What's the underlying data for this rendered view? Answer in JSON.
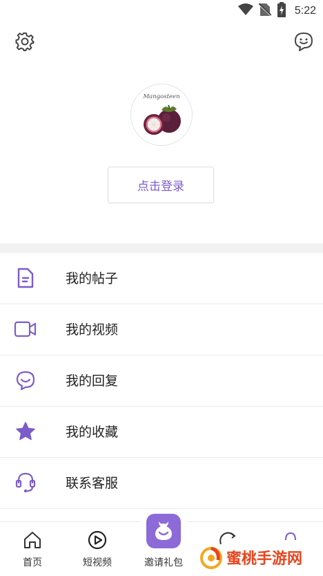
{
  "status_bar": {
    "time": "5:22"
  },
  "profile": {
    "avatar_text": "Mangosteen",
    "login_label": "点击登录"
  },
  "menu": {
    "items": [
      {
        "label": "我的帖子",
        "icon": "document-icon"
      },
      {
        "label": "我的视频",
        "icon": "video-camera-icon"
      },
      {
        "label": "我的回复",
        "icon": "chat-smile-icon"
      },
      {
        "label": "我的收藏",
        "icon": "star-icon"
      },
      {
        "label": "联系客服",
        "icon": "headset-icon"
      }
    ]
  },
  "bottom_nav": {
    "items": [
      {
        "label": "首页",
        "icon": "home-icon"
      },
      {
        "label": "短视频",
        "icon": "play-circle-icon"
      },
      {
        "label": "邀请礼包",
        "icon": "gift-bag-icon"
      }
    ]
  },
  "watermark": {
    "text": "蜜桃手游网"
  },
  "colors": {
    "accent": "#7c5cc9",
    "center_tab": "#8c6ad8",
    "divider": "#f2f2f2"
  }
}
